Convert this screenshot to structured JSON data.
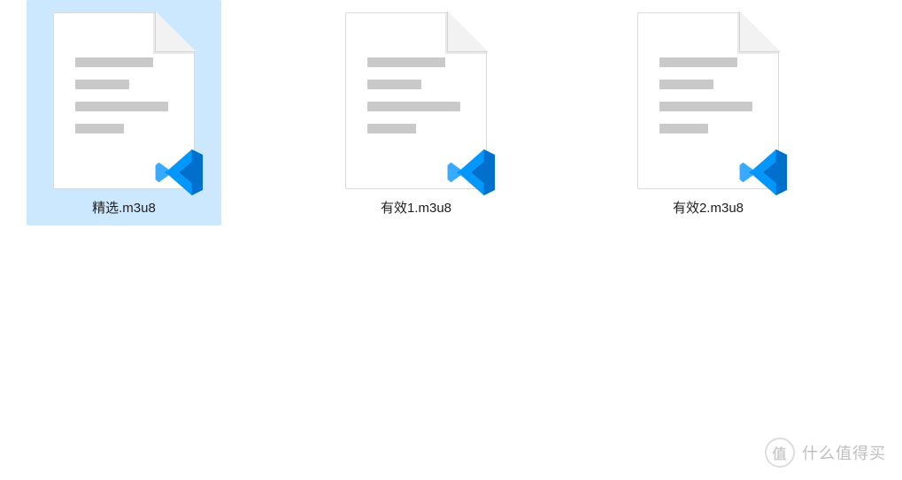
{
  "files": [
    {
      "name": "精选.m3u8",
      "selected": true
    },
    {
      "name": "有效1.m3u8",
      "selected": false
    },
    {
      "name": "有效2.m3u8",
      "selected": false
    }
  ],
  "watermark": {
    "badge": "值",
    "text": "什么值得买"
  }
}
